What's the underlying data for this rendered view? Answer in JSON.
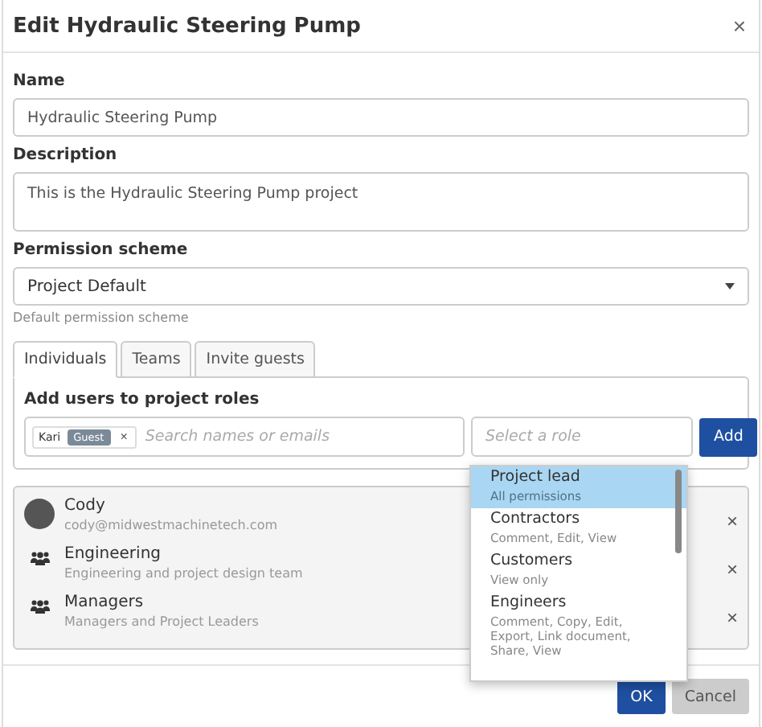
{
  "dialog": {
    "title": "Edit Hydraulic Steering Pump",
    "close": "×"
  },
  "name": {
    "label": "Name",
    "value": "Hydraulic Steering Pump"
  },
  "description": {
    "label": "Description",
    "value": "This is the Hydraulic Steering Pump project"
  },
  "permission_scheme": {
    "label": "Permission scheme",
    "value": "Project Default",
    "hint": "Default permission scheme"
  },
  "tabs": [
    {
      "label": "Individuals",
      "selected": true
    },
    {
      "label": "Teams",
      "selected": false
    },
    {
      "label": "Invite guests",
      "selected": false
    }
  ],
  "add_users": {
    "label": "Add users to project roles",
    "chip": {
      "name": "Kari",
      "badge": "Guest",
      "remove": "×"
    },
    "search_placeholder": "Search names or emails",
    "role_placeholder": "Select a role",
    "add_button": "Add"
  },
  "members": [
    {
      "kind": "user",
      "name": "Cody",
      "detail": "cody@midwestmachinetech.com",
      "remove": "×"
    },
    {
      "kind": "team",
      "name": "Engineering",
      "detail": "Engineering and project design team",
      "remove": "×"
    },
    {
      "kind": "team",
      "name": "Managers",
      "detail": "Managers and Project Leaders",
      "remove": "×"
    }
  ],
  "role_menu": [
    {
      "name": "Project lead",
      "detail": "All permissions",
      "selected": true
    },
    {
      "name": "Contractors",
      "detail": "Comment, Edit, View",
      "selected": false
    },
    {
      "name": "Customers",
      "detail": "View only",
      "selected": false
    },
    {
      "name": "Engineers",
      "detail": "Comment, Copy, Edit, Export, Link document, Share, View",
      "selected": false
    }
  ],
  "buttons": {
    "ok": "OK",
    "cancel": "Cancel"
  }
}
